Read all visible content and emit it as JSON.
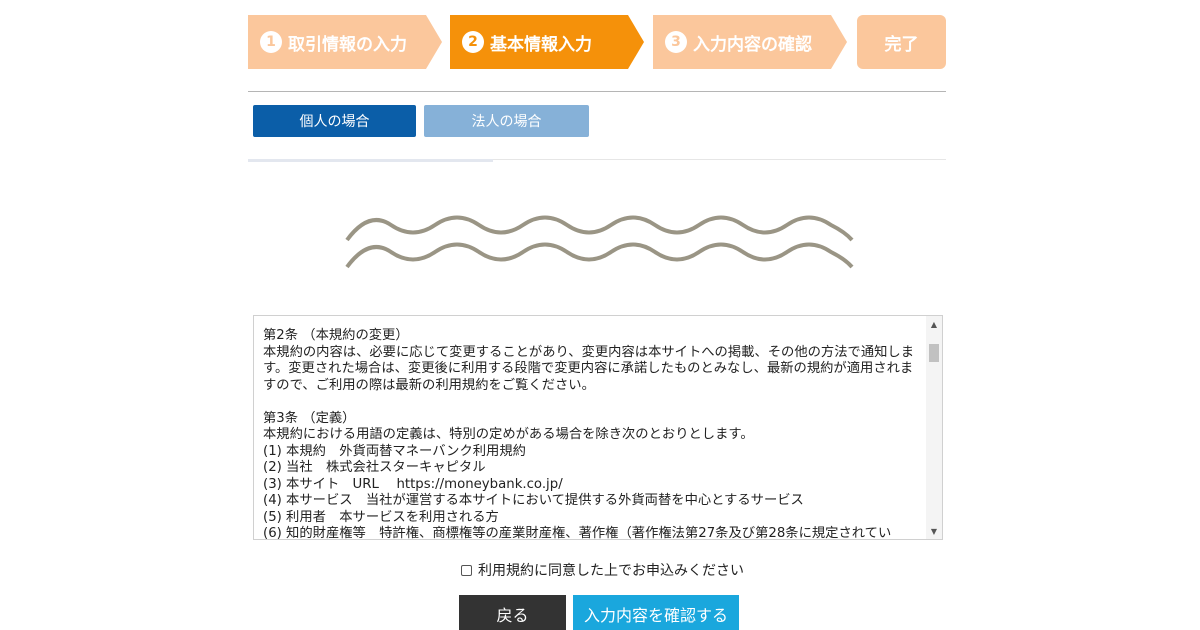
{
  "steps": [
    {
      "number": "1",
      "label": "取引情報の入力"
    },
    {
      "number": "2",
      "label": "基本情報入力"
    },
    {
      "number": "3",
      "label": "入力内容の確認"
    },
    {
      "label": "完了"
    }
  ],
  "tabs": {
    "personal": "個人の場合",
    "corporate": "法人の場合"
  },
  "terms": {
    "text": "第2条 （本規約の変更）\n本規約の内容は、必要に応じて変更することがあり、変更内容は本サイトへの掲載、その他の方法で通知します。変更された場合は、変更後に利用する段階で変更内容に承諾したものとみなし、最新の規約が適用されますので、ご利用の際は最新の利用規約をご覧ください。\n\n第3条 （定義）\n本規約における用語の定義は、特別の定めがある場合を除き次のとおりとします。\n(1) 本規約　外貨両替マネーバンク利用規約\n(2) 当社　株式会社スターキャピタル\n(3) 本サイト　URL　 https://moneybank.co.jp/\n(4) 本サービス　当社が運営する本サイトにおいて提供する外貨両替を中心とするサービス\n(5) 利用者　本サービスを利用される方\n(6) 知的財産権等　特許権、商標権等の産業財産権、著作権（著作権法第27条及び第28条に規定されてい"
  },
  "agree_label": "利用規約に同意した上でお申込みください",
  "buttons": {
    "back": "戻る",
    "confirm": "入力内容を確認する"
  },
  "colors": {
    "step_active": "#f5910a",
    "step_inactive": "#fbc79c",
    "tab_active": "#0b5ea8",
    "tab_inactive": "#86b1d8",
    "back_button": "#333333",
    "confirm_button": "#1aa7dd"
  }
}
